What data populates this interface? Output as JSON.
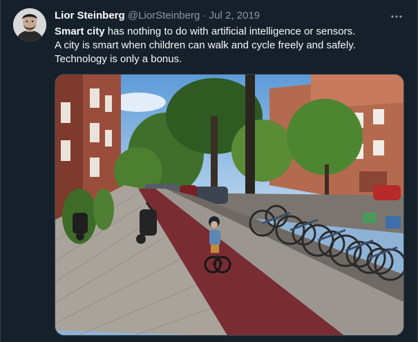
{
  "tweet": {
    "display_name": "Lior Steinberg",
    "handle": "@LiorSteinberg",
    "separator": "·",
    "date": "Jul 2, 2019",
    "text": {
      "line1_bold": "Smart city",
      "line1_rest": " has nothing to do with artificial intelligence or sensors.",
      "line2": "A city is smart when children can walk and cycle freely and safely.",
      "line3": "Technology is only a bonus."
    }
  },
  "icons": {
    "more": "more-horizontal-icon"
  },
  "colors": {
    "background": "#15202b",
    "text_primary": "#f7f9f9",
    "text_secondary": "#8b98a5",
    "border": "#38444d",
    "bike_lane": "#7a2c33"
  }
}
